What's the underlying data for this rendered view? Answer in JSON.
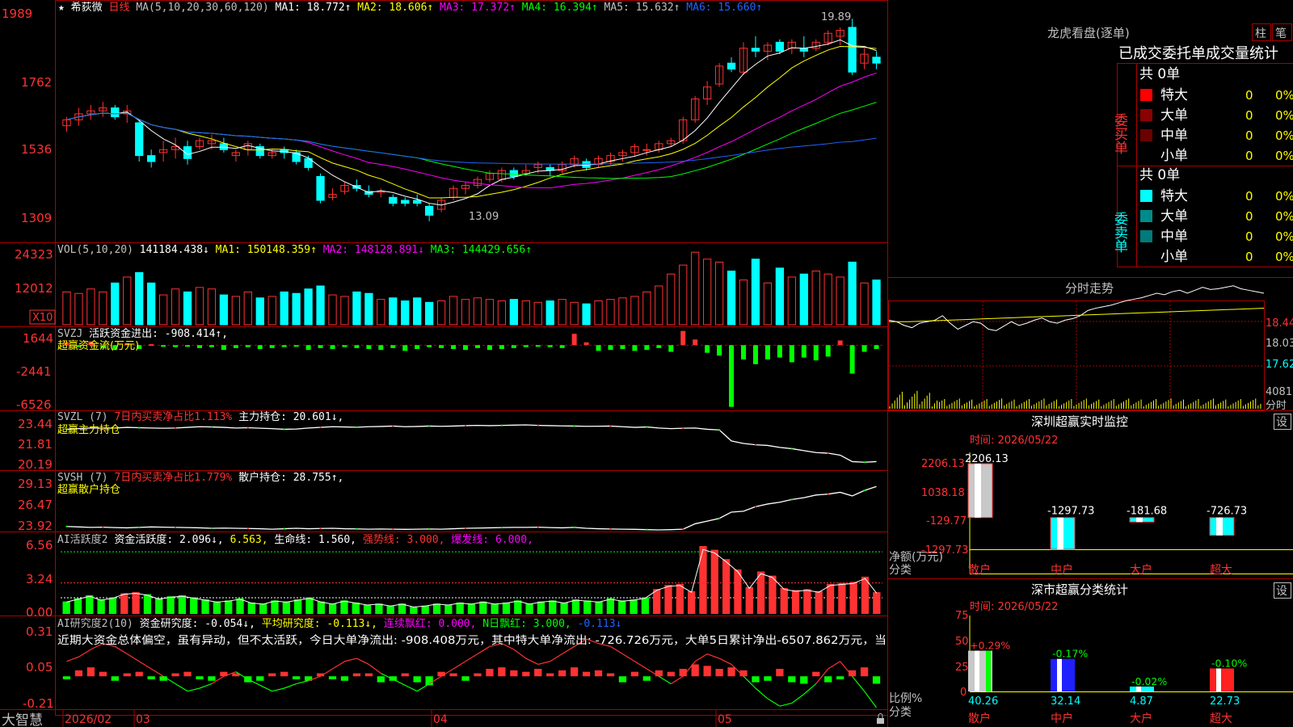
{
  "stock": {
    "name": "希荻微",
    "period": "日线"
  },
  "colors": {
    "up": "#ff3232",
    "down": "#00ffff",
    "ma1": "#ffffff",
    "ma2": "#ffff00",
    "ma3": "#ff00ff",
    "ma4": "#00ff00",
    "ma5": "#8080ff",
    "ma6": "#1e64ff",
    "grid": "#aa0000",
    "text": "#c0c0c0"
  },
  "ma_header": {
    "label": "MA(5,10,20,30,60,120)",
    "ma1": "MA1: 18.772↑",
    "ma2": "MA2: 18.606↑",
    "ma3": "MA3: 17.372↑",
    "ma4": "MA4: 16.394↑",
    "ma5": "MA5: 15.632↑",
    "ma6": "MA6: 15.660↑"
  },
  "price_axis": {
    "ticks": [
      "1989",
      "1762",
      "1536",
      "1309"
    ]
  },
  "annotations": {
    "high": "19.89",
    "low": "13.09"
  },
  "vol_header": {
    "label": "VOL(5,10,20)",
    "v": "141184.438↓",
    "ma1": "MA1: 150148.359↑",
    "ma2": "MA2: 148128.891↓",
    "ma3": "MA3: 144429.656↑"
  },
  "vol_axis": {
    "ticks": [
      "24323",
      "12012"
    ],
    "unit": "X10"
  },
  "svzj": {
    "title": "SVZJ",
    "text": "活跃资金进出: -908.414↑,",
    "sub": "超赢资金流(万元)",
    "ticks": [
      "1644",
      "-2441",
      "-6526"
    ]
  },
  "svzl": {
    "title": "SVZL (7)",
    "red": "7日内买卖净占比1.113%",
    "text": "主力持仓: 20.601↓,",
    "sub": "超赢主力持仓",
    "ticks": [
      "23.44",
      "21.81",
      "20.19"
    ]
  },
  "svsh": {
    "title": "SVSH (7)",
    "red": "7日内买卖净占比1.779%",
    "text": "散户持仓: 28.755↑,",
    "sub": "超赢散户持仓",
    "ticks": [
      "29.13",
      "26.47",
      "23.92"
    ]
  },
  "ai1": {
    "title": "AI活跃度2",
    "a": "资金活跃度: 2.096↓,",
    "b": "6.563,",
    "c": "生命线: 1.560,",
    "d": "强势线: 3.000,",
    "e": "爆发线: 6.000,",
    "ticks": [
      "6.56",
      "3.24",
      "0.00"
    ]
  },
  "ai2": {
    "title": "AI研究度2(10)",
    "a": "资金研究度: -0.054↓,",
    "b": "平均研究度: -0.113↓,",
    "c": "连续飘红: 0.000,",
    "d": "N日飘红: 3.000,",
    "e": "-0.113↓",
    "comment": "近期大资金总体偏空，虽有异动，但不太活跃，今日大单净流出: -908.408万元，其中特大单净流出: -726.726万元，大单5日累计净出-6507.862万元，当",
    "ticks": [
      "0.31",
      "0.05",
      "-0.21"
    ]
  },
  "time_axis": {
    "brand": "大智慧",
    "labels": [
      "2026/02",
      "03",
      "04",
      "05"
    ]
  },
  "lhb": {
    "title": "龙虎看盘(逐单)",
    "tab1": "柱",
    "tab2": "笔",
    "subtitle": "已成交委托单成交量统计",
    "buy_label": "委买单",
    "sell_label": "委卖单",
    "buy_total": "共 0单",
    "sell_total": "共 0单",
    "buy_rows": [
      {
        "name": "特大",
        "n": "0",
        "p": "0%"
      },
      {
        "name": "大单",
        "n": "0",
        "p": "0%"
      },
      {
        "name": "中单",
        "n": "0",
        "p": "0%"
      },
      {
        "name": "小单",
        "n": "0",
        "p": "0%"
      }
    ],
    "sell_rows": [
      {
        "name": "特大",
        "n": "0",
        "p": "0%"
      },
      {
        "name": "大单",
        "n": "0",
        "p": "0%"
      },
      {
        "name": "中单",
        "n": "0",
        "p": "0%"
      },
      {
        "name": "小单",
        "n": "0",
        "p": "0%"
      }
    ]
  },
  "intraday": {
    "title": "分时走势",
    "ticks": [
      "18.44",
      "18.03",
      "17.62"
    ],
    "vol_tick": "4081",
    "vol_label": "分时"
  },
  "monitor": {
    "title": "深圳超赢实时监控",
    "btn": "设",
    "date": "时间: 2026/05/22",
    "ticks": [
      "2206.13",
      "1038.18",
      "-129.77",
      "-1297.73"
    ],
    "ylabel": "净额(万元)",
    "xcat": "分类"
  },
  "classify": {
    "title": "深市超赢分类统计",
    "btn": "设",
    "date": "时间: 2026/05/22",
    "ticks": [
      "75",
      "50",
      "25",
      "0"
    ],
    "ylabel": "比例%",
    "xcat": "分类"
  },
  "chart_data": [
    {
      "type": "candlestick",
      "name": "price",
      "x": [
        "2026/02",
        "03",
        "04",
        "05"
      ],
      "ohlc": [
        [
          16.3,
          16.6,
          16.1,
          16.5
        ],
        [
          16.5,
          16.9,
          16.3,
          16.7
        ],
        [
          16.7,
          17.0,
          16.5,
          16.8
        ],
        [
          16.8,
          17.1,
          16.6,
          16.9
        ],
        [
          16.9,
          17.0,
          16.5,
          16.6
        ],
        [
          16.7,
          17.0,
          16.4,
          16.8
        ],
        [
          16.4,
          16.5,
          15.1,
          15.3
        ],
        [
          15.3,
          15.5,
          14.9,
          15.1
        ],
        [
          15.4,
          15.8,
          15.1,
          15.5
        ],
        [
          15.5,
          15.9,
          15.2,
          15.6
        ],
        [
          15.6,
          15.8,
          15.0,
          15.2
        ],
        [
          15.6,
          15.9,
          15.5,
          15.8
        ],
        [
          15.7,
          16.0,
          15.5,
          15.8
        ],
        [
          15.7,
          15.9,
          15.4,
          15.5
        ],
        [
          15.3,
          15.5,
          15.1,
          15.4
        ],
        [
          15.5,
          15.8,
          15.3,
          15.7
        ],
        [
          15.6,
          15.7,
          15.2,
          15.3
        ],
        [
          15.3,
          15.5,
          15.2,
          15.4
        ],
        [
          15.5,
          15.6,
          15.2,
          15.4
        ],
        [
          15.4,
          15.5,
          15.0,
          15.1
        ],
        [
          15.2,
          15.3,
          14.8,
          14.9
        ],
        [
          14.6,
          14.7,
          13.7,
          13.8
        ],
        [
          13.9,
          14.2,
          13.8,
          14.0
        ],
        [
          14.1,
          14.4,
          14.0,
          14.3
        ],
        [
          14.3,
          14.5,
          14.1,
          14.2
        ],
        [
          14.1,
          14.3,
          13.9,
          14.0
        ],
        [
          14.1,
          14.2,
          13.9,
          14.1
        ],
        [
          13.9,
          14.0,
          13.6,
          13.7
        ],
        [
          13.8,
          13.9,
          13.6,
          13.7
        ],
        [
          13.8,
          14.0,
          13.6,
          13.7
        ],
        [
          13.6,
          13.7,
          13.1,
          13.3
        ],
        [
          13.5,
          13.9,
          13.4,
          13.8
        ],
        [
          13.9,
          14.3,
          13.8,
          14.2
        ],
        [
          14.2,
          14.4,
          14.0,
          14.3
        ],
        [
          14.3,
          14.6,
          14.2,
          14.5
        ],
        [
          14.5,
          14.8,
          14.4,
          14.7
        ],
        [
          14.5,
          14.9,
          14.4,
          14.8
        ],
        [
          14.8,
          14.9,
          14.5,
          14.6
        ],
        [
          14.7,
          15.0,
          14.6,
          14.8
        ],
        [
          14.9,
          15.1,
          14.7,
          15.0
        ],
        [
          14.9,
          15.0,
          14.6,
          14.8
        ],
        [
          14.8,
          15.1,
          14.7,
          15.0
        ],
        [
          15.0,
          15.3,
          14.9,
          15.2
        ],
        [
          15.1,
          15.2,
          14.8,
          14.9
        ],
        [
          15.0,
          15.3,
          14.9,
          15.2
        ],
        [
          15.1,
          15.4,
          15.0,
          15.3
        ],
        [
          15.3,
          15.5,
          15.1,
          15.4
        ],
        [
          15.4,
          15.7,
          15.3,
          15.6
        ],
        [
          15.5,
          15.7,
          15.3,
          15.5
        ],
        [
          15.5,
          15.8,
          15.4,
          15.7
        ],
        [
          15.7,
          15.9,
          15.6,
          15.8
        ],
        [
          15.8,
          16.6,
          15.7,
          16.5
        ],
        [
          16.5,
          17.3,
          16.4,
          17.2
        ],
        [
          17.2,
          17.8,
          17.0,
          17.6
        ],
        [
          17.7,
          18.4,
          17.6,
          18.3
        ],
        [
          18.4,
          18.6,
          18.1,
          18.2
        ],
        [
          18.1,
          19.1,
          18.0,
          18.9
        ],
        [
          18.9,
          19.3,
          18.6,
          18.8
        ],
        [
          18.8,
          19.1,
          18.5,
          19.0
        ],
        [
          19.1,
          19.2,
          18.7,
          18.8
        ],
        [
          18.9,
          19.2,
          18.7,
          19.1
        ],
        [
          18.9,
          19.3,
          18.6,
          18.8
        ],
        [
          18.9,
          19.2,
          18.8,
          19.1
        ],
        [
          19.1,
          19.5,
          19.0,
          19.4
        ],
        [
          19.3,
          19.6,
          19.0,
          19.5
        ],
        [
          19.6,
          19.89,
          18.0,
          18.1
        ],
        [
          18.4,
          18.9,
          18.2,
          18.7
        ],
        [
          18.6,
          18.8,
          18.2,
          18.4
        ]
      ],
      "ylim": [
        12.5,
        20.3
      ]
    },
    {
      "type": "bar",
      "name": "VOL(5,10,20)",
      "unit": "X10",
      "values": [
        11000,
        10500,
        12000,
        11000,
        14000,
        16000,
        17500,
        14000,
        10000,
        12000,
        11000,
        12500,
        12000,
        10000,
        9500,
        11000,
        9000,
        9500,
        11000,
        10500,
        12000,
        13000,
        10000,
        9500,
        11000,
        10500,
        8500,
        9000,
        8000,
        9000,
        7500,
        8000,
        9500,
        8500,
        9000,
        8500,
        8000,
        8500,
        8000,
        7500,
        8000,
        8500,
        7500,
        7000,
        8000,
        8500,
        9000,
        9500,
        11000,
        13000,
        17000,
        20000,
        24323,
        22000,
        21000,
        18000,
        15000,
        22000,
        14000,
        19000,
        16000,
        17000,
        18000,
        17000,
        16000,
        21000,
        14000,
        15000
      ],
      "ylim": [
        0,
        26000
      ]
    },
    {
      "type": "bar",
      "name": "SVZJ 活跃资金进出",
      "values": [
        300,
        -200,
        400,
        -300,
        -500,
        200,
        -400,
        100,
        -100,
        -200,
        -100,
        -300,
        -200,
        -500,
        -300,
        -200,
        -400,
        -300,
        -200,
        -100,
        -500,
        -300,
        -400,
        -200,
        -300,
        -400,
        -500,
        -300,
        -600,
        -400,
        -200,
        -300,
        -400,
        -500,
        -300,
        -500,
        -400,
        -300,
        -200,
        -100,
        -200,
        -300,
        1200,
        300,
        -600,
        -500,
        -400,
        -600,
        -500,
        -300,
        -700,
        1500,
        600,
        -800,
        -1100,
        -6500,
        -1500,
        -2000,
        -1500,
        -1300,
        -1800,
        -1300,
        -1600,
        -1200,
        500,
        -3000,
        -700,
        -400
      ],
      "ylim": [
        -6526,
        1644
      ]
    },
    {
      "type": "line",
      "name": "SVZL 主力持仓",
      "values": [
        23.1,
        23.15,
        23.2,
        23.18,
        23.2,
        23.25,
        23.22,
        23.2,
        23.18,
        23.2,
        23.25,
        23.3,
        23.28,
        23.25,
        23.2,
        23.22,
        23.18,
        23.15,
        23.1,
        23.12,
        23.2,
        23.25,
        23.3,
        23.28,
        23.26,
        23.3,
        23.32,
        23.35,
        23.3,
        23.32,
        23.35,
        23.33,
        23.35,
        23.38,
        23.4,
        23.38,
        23.4,
        23.42,
        23.44,
        23.4,
        23.38,
        23.36,
        23.35,
        23.33,
        23.34,
        23.35,
        23.3,
        23.25,
        23.28,
        23.2,
        23.15,
        23.18,
        23.2,
        23.1,
        23.05,
        22.2,
        22.0,
        21.9,
        21.85,
        21.7,
        21.6,
        21.45,
        21.3,
        21.25,
        21.1,
        20.6,
        20.55,
        20.6
      ],
      "ylim": [
        20.19,
        23.44
      ]
    },
    {
      "type": "line",
      "name": "SVSH 散户持仓",
      "values": [
        24.3,
        24.25,
        24.2,
        24.22,
        24.18,
        24.15,
        24.2,
        24.25,
        24.22,
        24.2,
        24.18,
        24.15,
        24.1,
        24.12,
        24.1,
        24.08,
        24.05,
        24.0,
        24.05,
        24.1,
        24.05,
        24.08,
        24.1,
        24.05,
        24.03,
        24.0,
        24.02,
        24.0,
        23.98,
        24.0,
        24.02,
        24.0,
        24.05,
        24.1,
        24.12,
        24.15,
        24.18,
        24.2,
        24.2,
        24.22,
        24.18,
        24.15,
        24.2,
        24.1,
        24.05,
        24.02,
        24.0,
        23.98,
        23.95,
        23.92,
        23.95,
        24.0,
        24.6,
        24.9,
        25.2,
        25.9,
        26.0,
        26.5,
        26.8,
        27.0,
        27.3,
        27.5,
        27.8,
        27.9,
        28.1,
        27.7,
        28.3,
        28.75
      ],
      "ylim": [
        23.92,
        29.13
      ]
    },
    {
      "type": "bar",
      "name": "AI活跃度2 资金活跃度",
      "values": [
        1.2,
        1.5,
        1.8,
        1.4,
        1.6,
        2.0,
        2.1,
        1.9,
        1.5,
        1.7,
        1.8,
        1.6,
        1.4,
        1.2,
        1.3,
        1.5,
        1.1,
        1.0,
        1.3,
        1.2,
        1.4,
        1.6,
        1.2,
        1.0,
        1.3,
        1.1,
        0.9,
        1.0,
        0.8,
        1.0,
        0.7,
        0.8,
        1.0,
        0.9,
        1.1,
        1.0,
        1.2,
        1.0,
        1.1,
        1.3,
        1.0,
        1.2,
        1.3,
        1.1,
        1.4,
        1.3,
        1.2,
        1.5,
        1.3,
        1.4,
        1.6,
        2.4,
        2.8,
        2.9,
        2.2,
        6.56,
        6.2,
        5.3,
        4.3,
        2.6,
        4.1,
        3.7,
        2.5,
        2.3,
        2.4,
        2.2,
        2.9,
        3.0,
        3.1,
        3.6,
        2.1
      ],
      "lines": {
        "生命线": 1.56,
        "强势线": 3.0,
        "爆发线": 6.0
      },
      "ylim": [
        0,
        6.56
      ]
    },
    {
      "type": "bar",
      "name": "AI研究度2 资金研究度",
      "values": [
        -0.02,
        0.04,
        0.06,
        0.03,
        -0.03,
        0.02,
        0.03,
        -0.02,
        -0.03,
        0.02,
        0.03,
        -0.02,
        -0.03,
        0.03,
        0.02,
        -0.04,
        -0.03,
        0.02,
        0.03,
        -0.02,
        -0.03,
        0.02,
        -0.02,
        -0.03,
        0.02,
        0.02,
        -0.04,
        -0.03,
        0.02,
        -0.04,
        -0.06,
        0.03,
        0.02,
        -0.03,
        0.02,
        0.05,
        0.06,
        0.04,
        0.03,
        0.05,
        0.02,
        0.04,
        0.06,
        0.03,
        0.04,
        0.02,
        -0.04,
        0.03,
        -0.03,
        0.04,
        0.03,
        0.05,
        0.08,
        0.07,
        0.05,
        0.06,
        0.04,
        -0.04,
        -0.03,
        0.05,
        -0.04,
        -0.05,
        0.03,
        -0.04,
        -0.02,
        0.04,
        0.06,
        -0.05
      ],
      "line": [
        0.1,
        0.13,
        0.18,
        0.22,
        0.2,
        0.15,
        0.1,
        0.05,
        0.0,
        -0.05,
        -0.1,
        -0.08,
        -0.05,
        0.0,
        0.03,
        -0.02,
        -0.06,
        -0.1,
        -0.08,
        -0.05,
        -0.03,
        0.0,
        0.05,
        0.1,
        0.12,
        0.08,
        0.02,
        -0.02,
        -0.06,
        -0.1,
        -0.05,
        0.0,
        0.05,
        0.1,
        0.15,
        0.2,
        0.22,
        0.18,
        0.12,
        0.08,
        0.1,
        0.15,
        0.2,
        0.25,
        0.22,
        0.2,
        0.15,
        0.1,
        0.05,
        0.0,
        -0.05,
        0.0,
        0.1,
        0.15,
        0.12,
        0.08,
        0.0,
        -0.08,
        -0.15,
        -0.2,
        -0.18,
        -0.12,
        -0.05,
        0.05,
        0.1,
        0.0,
        -0.1,
        -0.21
      ],
      "ylim": [
        -0.21,
        0.31
      ]
    },
    {
      "type": "line",
      "name": "分时走势",
      "values": [
        18.22,
        18.2,
        18.15,
        18.12,
        18.18,
        18.2,
        18.22,
        18.28,
        18.18,
        18.1,
        18.15,
        18.2,
        18.18,
        18.1,
        18.08,
        18.14,
        18.2,
        18.15,
        18.18,
        18.22,
        18.25,
        18.2,
        18.18,
        18.22,
        18.24,
        18.28,
        18.35,
        18.38,
        18.4,
        18.42,
        18.45,
        18.48,
        18.5,
        18.52,
        18.55,
        18.58,
        18.56,
        18.6,
        18.62,
        18.58,
        18.62,
        18.66,
        18.63,
        18.64,
        18.66,
        18.68,
        18.64,
        18.62,
        18.6,
        18.58
      ],
      "avg": [
        18.2,
        18.2,
        18.21,
        18.22,
        18.23,
        18.24,
        18.25,
        18.26,
        18.27,
        18.28,
        18.29,
        18.3,
        18.31,
        18.32,
        18.33,
        18.34,
        18.35,
        18.36,
        18.37,
        18.38
      ],
      "ylim": [
        17.62,
        18.44
      ]
    },
    {
      "type": "bar",
      "name": "深圳超赢实时监控",
      "categories": [
        "散户",
        "中户",
        "大户",
        "超大"
      ],
      "values": [
        2206.13,
        -1297.73,
        -181.68,
        -726.73
      ],
      "ylim": [
        -1297.73,
        2206.13
      ]
    },
    {
      "type": "bar",
      "name": "深市超赢分类统计",
      "categories": [
        "散户",
        "中户",
        "大户",
        "超大"
      ],
      "values": [
        40.26,
        32.14,
        4.87,
        22.73
      ],
      "changes": [
        "+0.29%",
        "-0.17%",
        "-0.02%",
        "-0.10%"
      ],
      "ylim": [
        0,
        75
      ]
    }
  ]
}
